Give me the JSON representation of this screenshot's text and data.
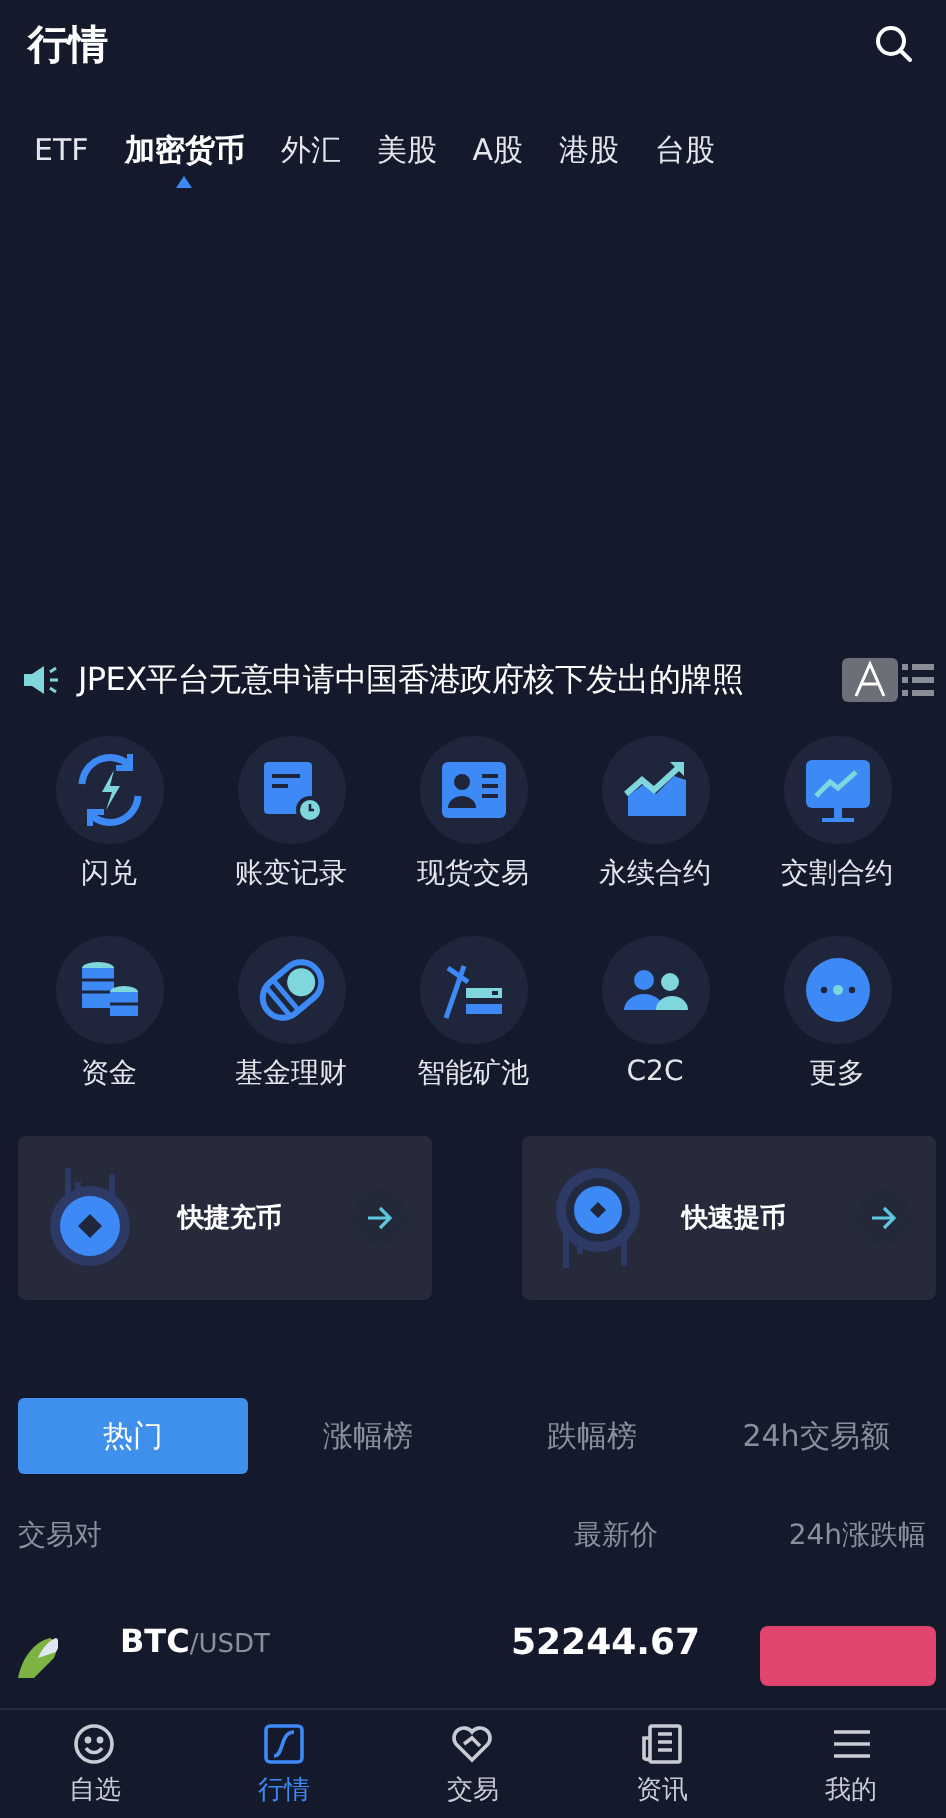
{
  "header": {
    "title": "行情"
  },
  "market_tabs": [
    {
      "label": "ETF",
      "selected": false
    },
    {
      "label": "加密货币",
      "selected": true
    },
    {
      "label": "外汇",
      "selected": false
    },
    {
      "label": "美股",
      "selected": false
    },
    {
      "label": "A股",
      "selected": false
    },
    {
      "label": "港股",
      "selected": false
    },
    {
      "label": "台股",
      "selected": false
    }
  ],
  "announcement": {
    "text": "JPEX平台无意申请中国香港政府核下发出的牌照"
  },
  "shortcuts": [
    {
      "label": "闪兑",
      "kind": "flash"
    },
    {
      "label": "账变记录",
      "kind": "record"
    },
    {
      "label": "现货交易",
      "kind": "spot"
    },
    {
      "label": "永续合约",
      "kind": "perpetual"
    },
    {
      "label": "交割合约",
      "kind": "delivery"
    },
    {
      "label": "资金",
      "kind": "funds"
    },
    {
      "label": "基金理财",
      "kind": "fund"
    },
    {
      "label": "智能矿池",
      "kind": "mining"
    },
    {
      "label": "C2C",
      "kind": "c2c"
    },
    {
      "label": "更多",
      "kind": "more"
    }
  ],
  "quick_cards": [
    {
      "label": "快捷充币",
      "kind": "deposit"
    },
    {
      "label": "快速提币",
      "kind": "withdraw"
    }
  ],
  "ranking_tabs": [
    {
      "label": "热门",
      "selected": true
    },
    {
      "label": "涨幅榜",
      "selected": false
    },
    {
      "label": "跌幅榜",
      "selected": false
    },
    {
      "label": "24h交易额",
      "selected": false
    }
  ],
  "table": {
    "columns": [
      "交易对",
      "最新价",
      "24h涨跌幅"
    ],
    "rows": [
      {
        "base": "BTC",
        "quote": "/USDT",
        "price": "52244.67",
        "color": "#e1456b"
      }
    ]
  },
  "bottom_nav": [
    {
      "label": "自选",
      "kind": "smile",
      "selected": false
    },
    {
      "label": "行情",
      "kind": "chart",
      "selected": true
    },
    {
      "label": "交易",
      "kind": "heart",
      "selected": false
    },
    {
      "label": "资讯",
      "kind": "news",
      "selected": false
    },
    {
      "label": "我的",
      "kind": "menu",
      "selected": false
    }
  ]
}
